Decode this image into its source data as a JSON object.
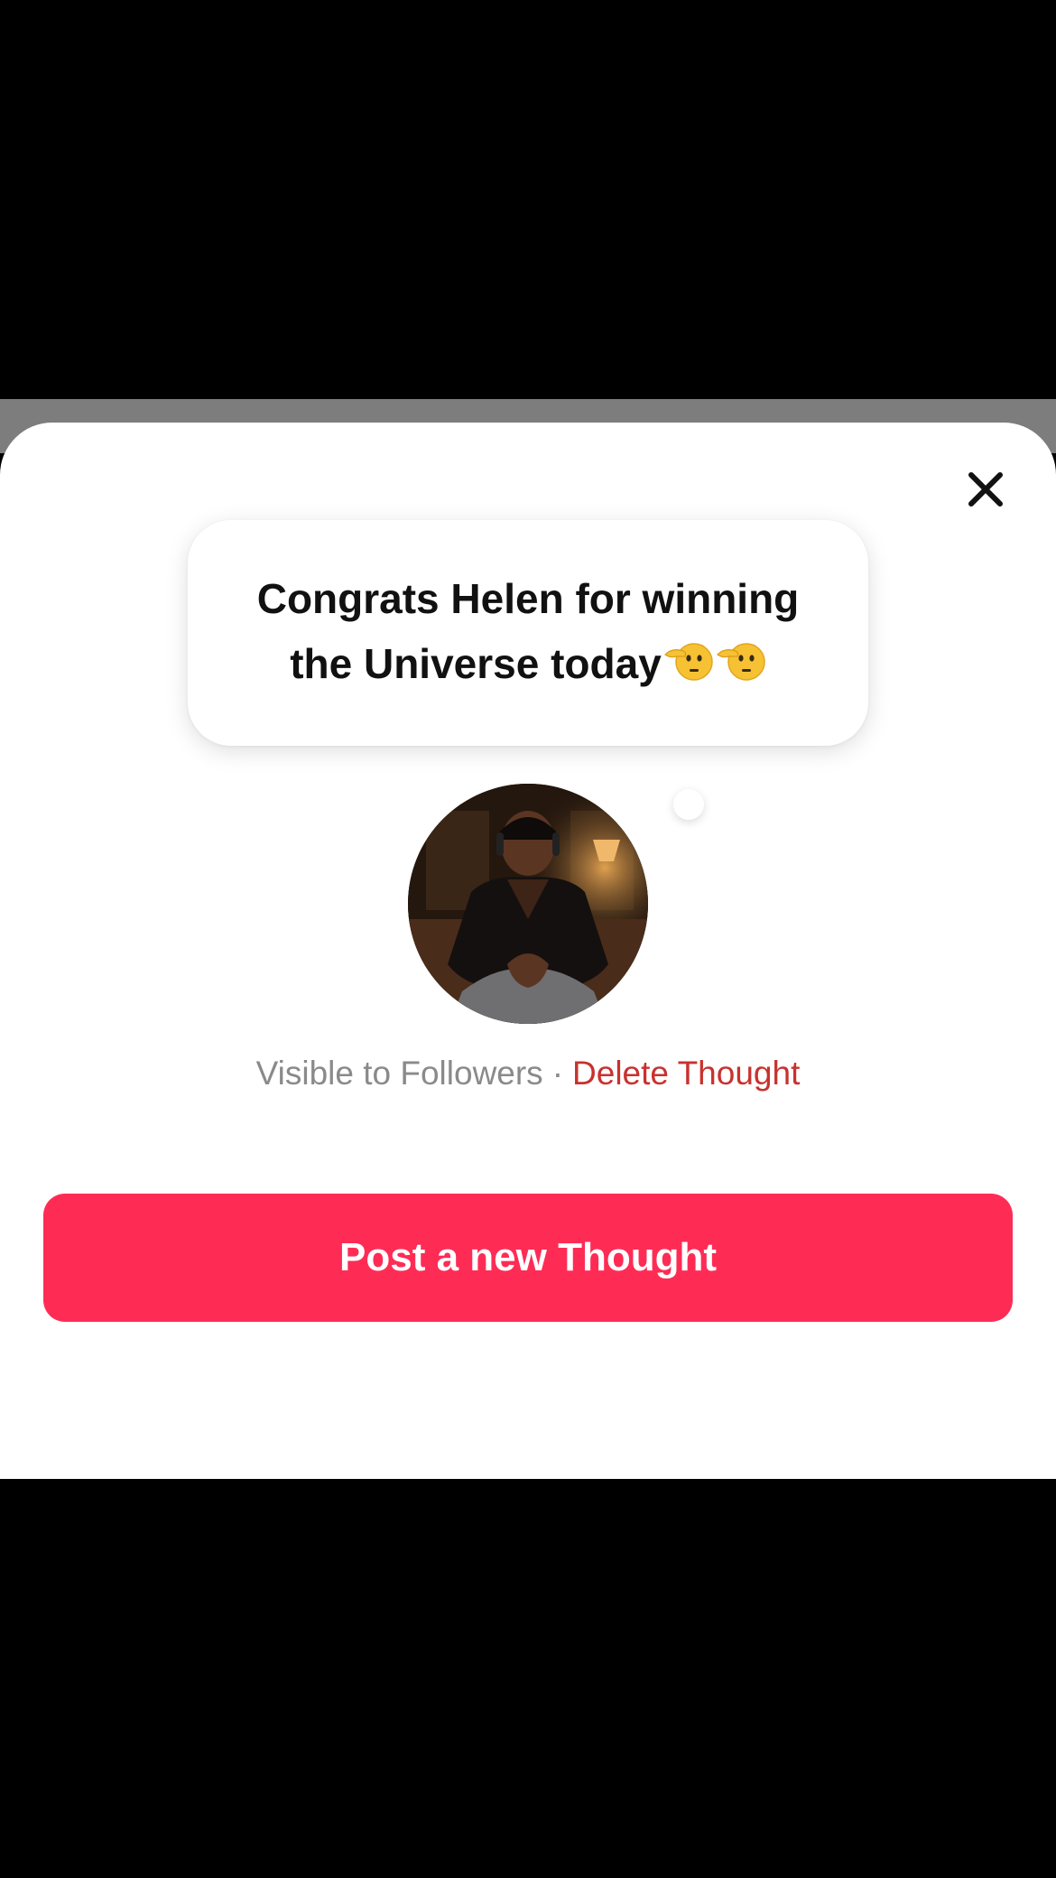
{
  "sheet": {
    "close_icon": "close-icon"
  },
  "thought": {
    "text": "Congrats Helen for winning the Universe today",
    "emojis": [
      "pointing-face-emoji",
      "pointing-face-emoji"
    ]
  },
  "avatar": {
    "description_icon": "profile-photo"
  },
  "visibility": {
    "label": "Visible to Followers",
    "separator": "·",
    "delete_label": "Delete Thought"
  },
  "actions": {
    "post_label": "Post a new Thought"
  },
  "colors": {
    "accent": "#fe2c55",
    "danger": "#c8322e",
    "muted": "#8a8a8a"
  }
}
